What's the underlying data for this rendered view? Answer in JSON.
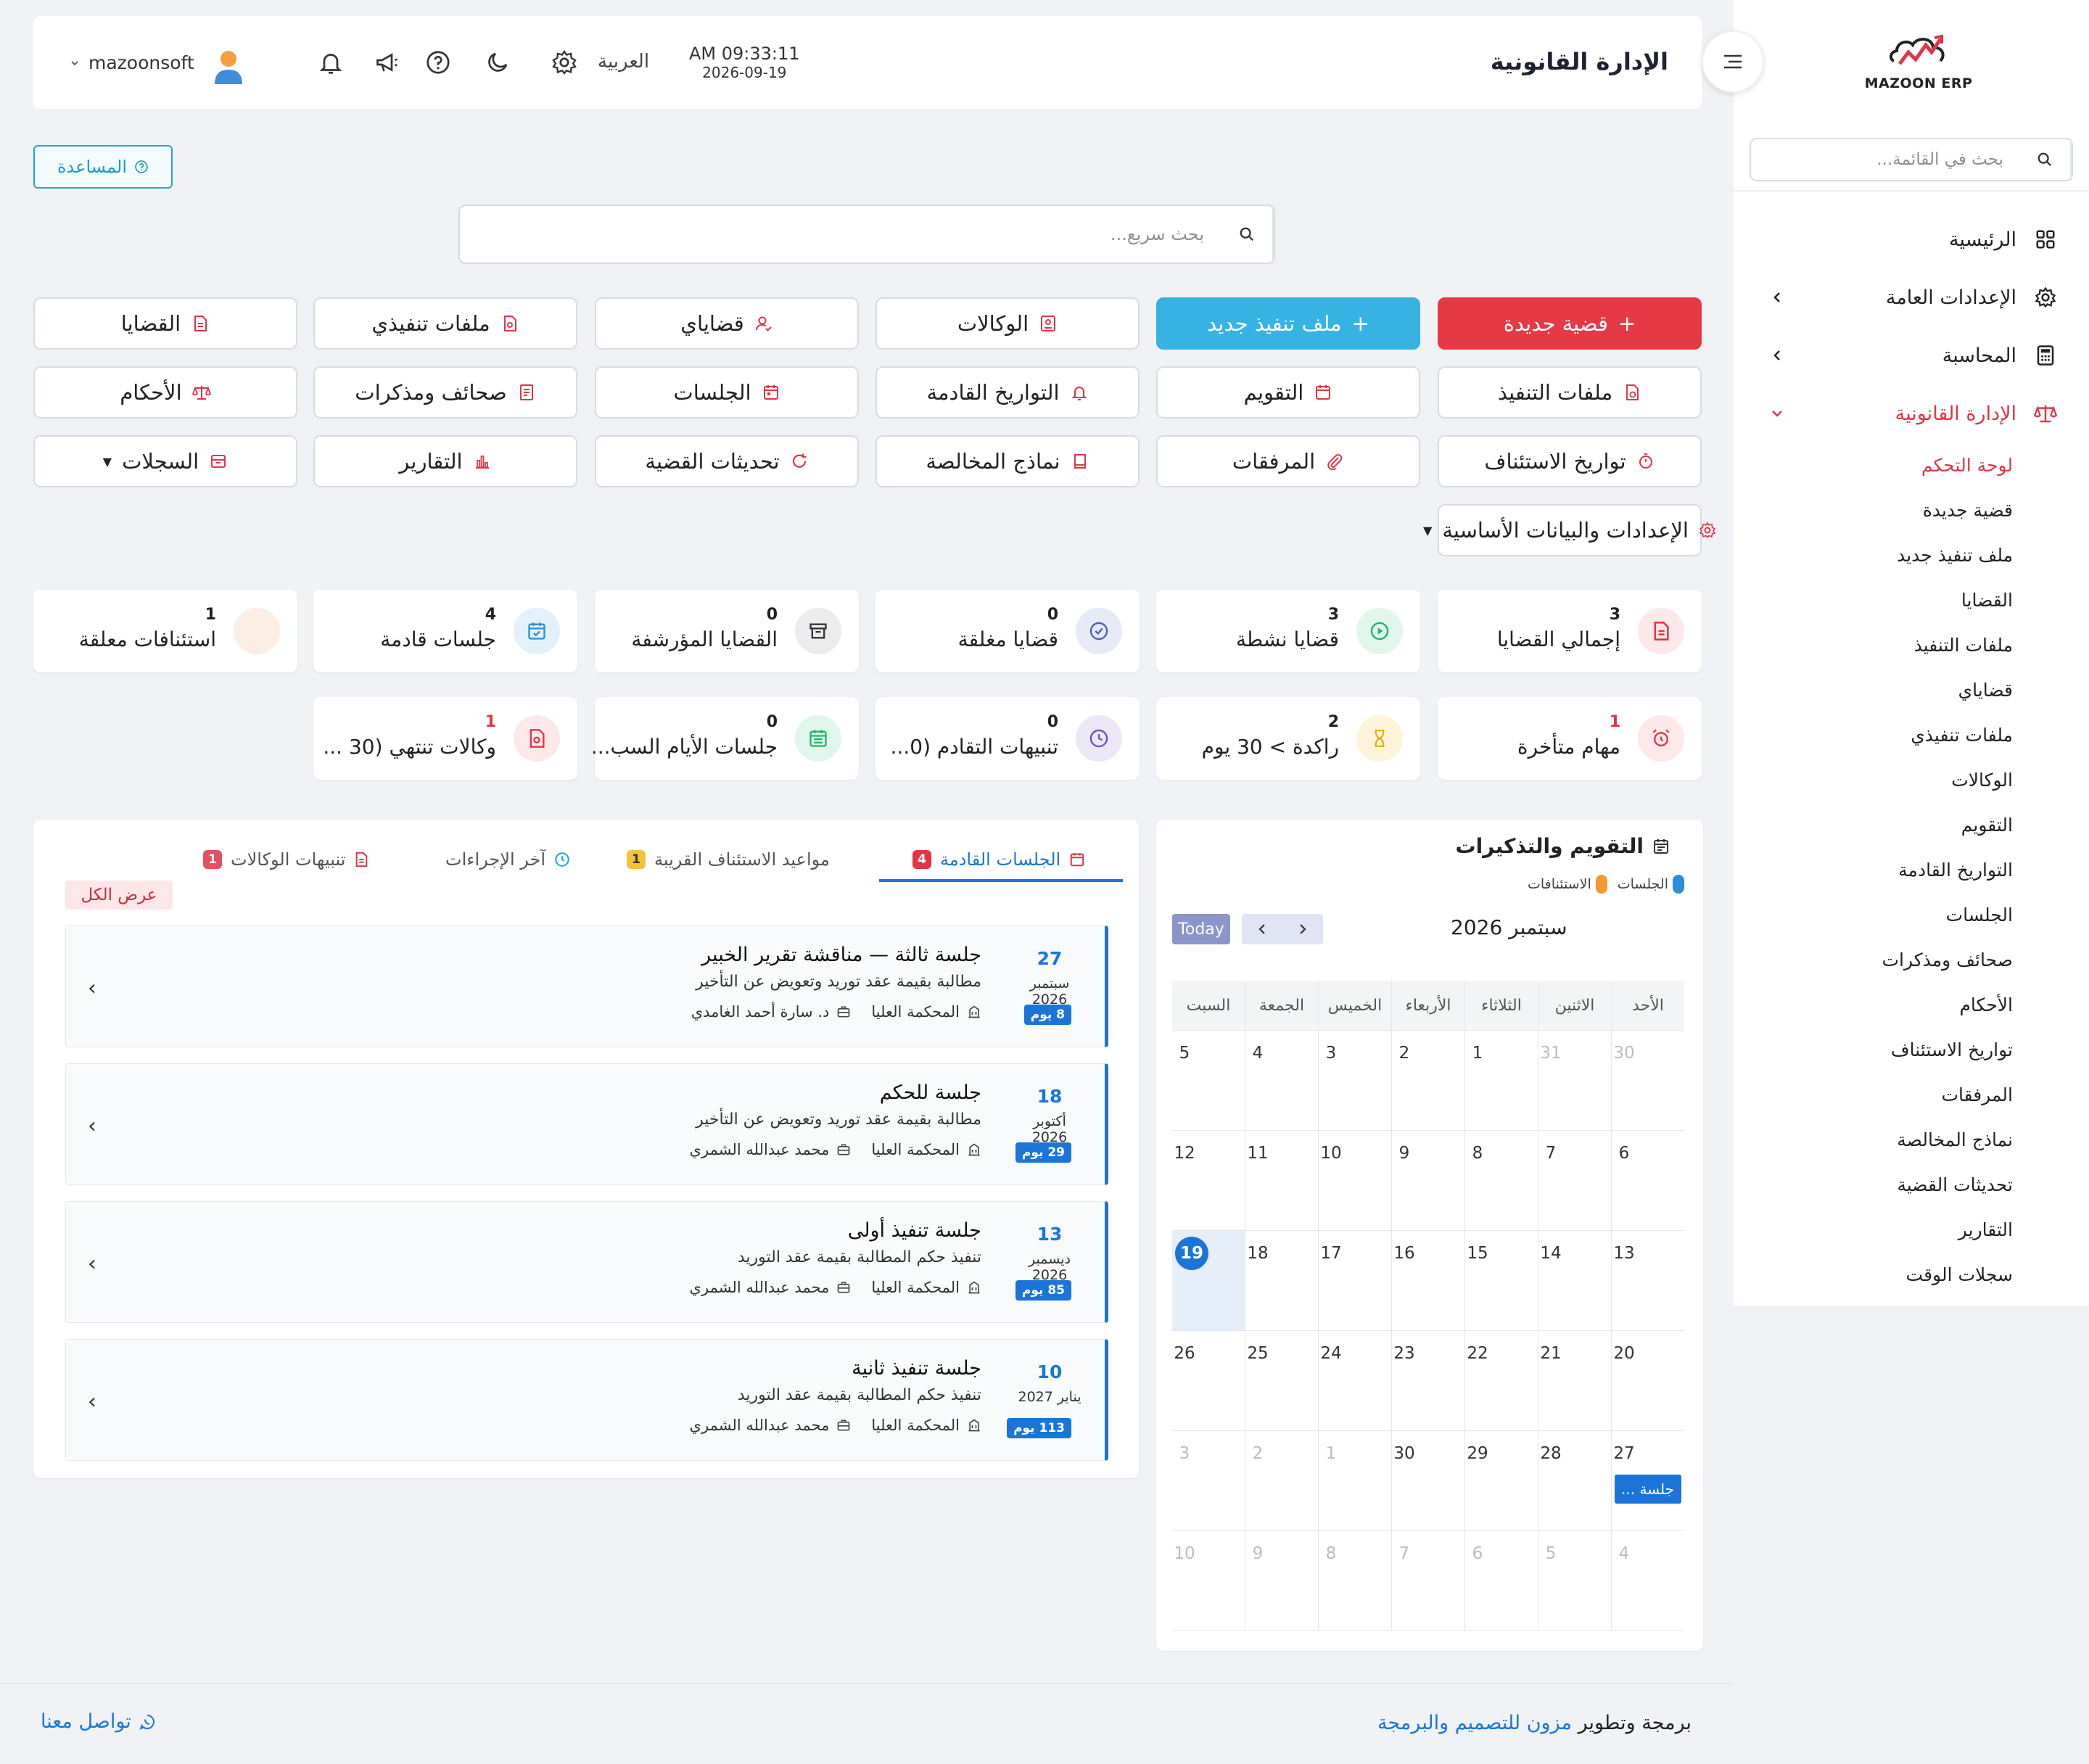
{
  "sidebar": {
    "logo_text": "MAZOON ERP",
    "search_placeholder": "بحث في القائمة...",
    "items": [
      {
        "label": "الرئيسية"
      },
      {
        "label": "الإعدادات العامة"
      },
      {
        "label": "المحاسبة"
      },
      {
        "label": "الإدارة القانونية"
      }
    ],
    "subitems": [
      "لوحة التحكم",
      "قضية جديدة",
      "ملف تنفيذ جديد",
      "القضايا",
      "ملفات التنفيذ",
      "قضاياي",
      "ملفات تنفيذي",
      "الوكالات",
      "التقويم",
      "التواريخ القادمة",
      "الجلسات",
      "صحائف ومذكرات",
      "الأحكام",
      "تواريخ الاستئناف",
      "المرفقات",
      "نماذج المخالصة",
      "تحديثات القضية",
      "التقارير",
      "سجلات الوقت"
    ]
  },
  "header": {
    "title": "الإدارة القانونية",
    "time": "AM 09:33:11",
    "date": "2026-09-19",
    "language": "العربية",
    "username": "mazoonsoft"
  },
  "help_label": "المساعدة",
  "quick_search_placeholder": "بحث سريع...",
  "buttons": {
    "new_case": "قضية جديدة",
    "new_exec": "ملف تنفيذ جديد",
    "agencies": "الوكالات",
    "my_cases": "قضاياي",
    "my_exec": "ملفات تنفيذي",
    "cases": "القضايا",
    "exec_files": "ملفات التنفيذ",
    "calendar": "التقويم",
    "upcoming": "التواريخ القادمة",
    "sessions": "الجلسات",
    "memos": "صحائف ومذكرات",
    "judgments": "الأحكام",
    "appeals": "تواريخ الاستئناف",
    "attachments": "المرفقات",
    "clearance": "نماذج المخالصة",
    "updates": "تحديثات القضية",
    "reports": "التقارير",
    "logs": "السجلات",
    "settings": "الإعدادات والبيانات الأساسية"
  },
  "stats": [
    {
      "num": "3",
      "label": "إجمالي القضايا"
    },
    {
      "num": "3",
      "label": "قضايا نشطة"
    },
    {
      "num": "0",
      "label": "قضايا مغلقة"
    },
    {
      "num": "0",
      "label": "القضايا المؤرشفة"
    },
    {
      "num": "4",
      "label": "جلسات قادمة"
    },
    {
      "num": "1",
      "label": "استئنافات معلقة"
    },
    {
      "num": "1",
      "label": "مهام متأخرة"
    },
    {
      "num": "2",
      "label": "راكدة > 30 يوم"
    },
    {
      "num": "0",
      "label": "تنبيهات التقادم (0..."
    },
    {
      "num": "0",
      "label": "جلسات الأيام السب..."
    },
    {
      "num": "1",
      "label": "وكالات تنتهي (30 ..."
    }
  ],
  "calendar": {
    "title": "التقويم والتذكيرات",
    "legend": [
      "الجلسات",
      "الاستئنافات"
    ],
    "month": "سبتمبر 2026",
    "today_label": "Today",
    "weekdays": [
      "الأحد",
      "الاثنين",
      "الثلاثاء",
      "الأربعاء",
      "الخميس",
      "الجمعة",
      "السبت"
    ],
    "weeks": [
      [
        "30",
        "31",
        "1",
        "2",
        "3",
        "4",
        "5"
      ],
      [
        "6",
        "7",
        "8",
        "9",
        "10",
        "11",
        "12"
      ],
      [
        "13",
        "14",
        "15",
        "16",
        "17",
        "18",
        "19"
      ],
      [
        "20",
        "21",
        "22",
        "23",
        "24",
        "25",
        "26"
      ],
      [
        "27",
        "28",
        "29",
        "30",
        "1",
        "2",
        "3"
      ],
      [
        "4",
        "5",
        "6",
        "7",
        "8",
        "9",
        "10"
      ]
    ],
    "event_label": "جلسة ..."
  },
  "tabs": [
    {
      "label": "الجلسات القادمة",
      "badge": "4"
    },
    {
      "label": "مواعيد الاستئناف القريبة",
      "badge": "1"
    },
    {
      "label": "آخر الإجراءات"
    },
    {
      "label": "تنبيهات الوكالات",
      "badge": "1"
    }
  ],
  "view_all": "عرض الكل",
  "sessions": [
    {
      "day": "27",
      "month": "سبتمبر 2026",
      "days_left": "8 يوم",
      "title": "جلسة ثالثة — مناقشة تقرير الخبير",
      "desc": "مطالبة بقيمة عقد توريد وتعويض عن التأخير",
      "court": "المحكمة العليا",
      "person": "د. سارة أحمد الغامدي"
    },
    {
      "day": "18",
      "month": "أكتوبر 2026",
      "days_left": "29 يوم",
      "title": "جلسة للحكم",
      "desc": "مطالبة بقيمة عقد توريد وتعويض عن التأخير",
      "court": "المحكمة العليا",
      "person": "محمد عبدالله الشمري"
    },
    {
      "day": "13",
      "month": "ديسمبر 2026",
      "days_left": "85 يوم",
      "title": "جلسة تنفيذ أولى",
      "desc": "تنفيذ حكم المطالبة بقيمة عقد التوريد",
      "court": "المحكمة العليا",
      "person": "محمد عبدالله الشمري"
    },
    {
      "day": "10",
      "month": "يناير 2027",
      "days_left": "113 يوم",
      "title": "جلسة تنفيذ ثانية",
      "desc": "تنفيذ حكم المطالبة بقيمة عقد التوريد",
      "court": "المحكمة العليا",
      "person": "محمد عبدالله الشمري"
    }
  ],
  "footer": {
    "credit_prefix": "برمجة وتطوير",
    "company": "مزون للتصميم والبرمجة",
    "contact": "تواصل معنا"
  },
  "colors": {
    "accent": "#1b75d8",
    "danger": "#e63946",
    "info": "#37b3e3"
  }
}
